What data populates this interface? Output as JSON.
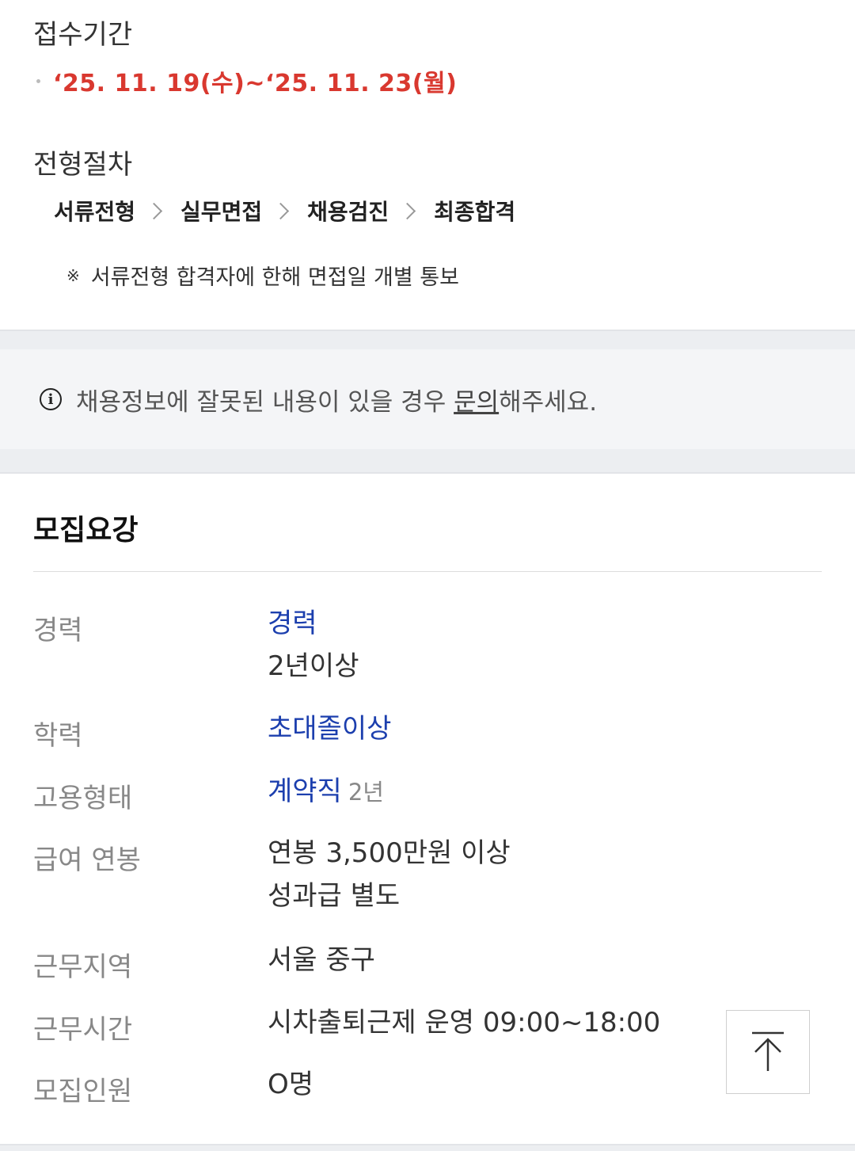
{
  "application": {
    "label": "접수기간",
    "period": "‘25. 11. 19(수)~‘25. 11. 23(월)"
  },
  "process": {
    "label": "전형절차",
    "steps": [
      "서류전형",
      "실무면접",
      "채용검진",
      "최종합격"
    ],
    "note_mark": "※",
    "note": "서류전형 합격자에 한해 면접일 개별 통보"
  },
  "notice": {
    "icon": "info-icon",
    "text_before": "채용정보에 잘못된 내용이 있을 경우 ",
    "link": "문의",
    "text_after": "해주세요."
  },
  "requirements": {
    "title": "모집요강",
    "career": {
      "label": "경력",
      "value": "경력",
      "detail": "2년이상"
    },
    "education": {
      "label": "학력",
      "value": "초대졸이상"
    },
    "employment": {
      "label": "고용형태",
      "value": "계약직",
      "detail": "2년"
    },
    "salary": {
      "label": "급여 연봉",
      "line1": "연봉 3,500만원 이상",
      "line2": "성과급 별도"
    },
    "location": {
      "label": "근무지역",
      "value": "서울 중구"
    },
    "hours": {
      "label": "근무시간",
      "value": "시차출퇴근제 운영 09:00~18:00"
    },
    "headcount": {
      "label": "모집인원",
      "value": "O명"
    }
  },
  "scroll_top": {
    "icon": "arrow-up-icon"
  },
  "colors": {
    "accent_red": "#d9382f",
    "accent_blue": "#1c3fae",
    "band_gray": "#eceef1"
  }
}
